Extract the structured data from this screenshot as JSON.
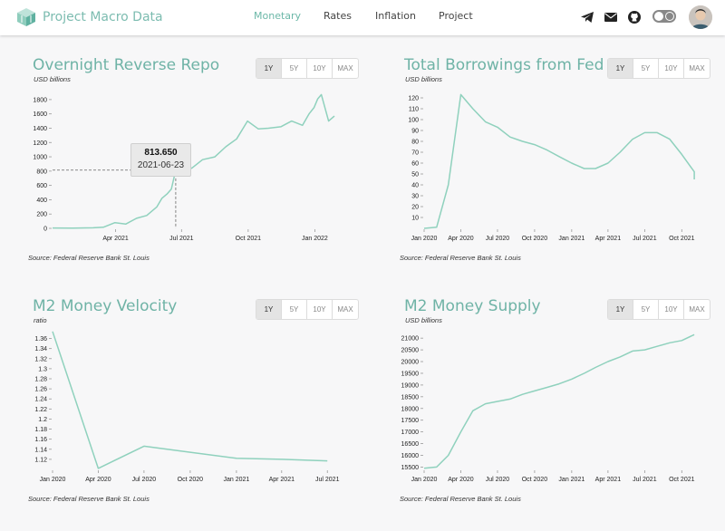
{
  "header": {
    "brand": "Project Macro Data",
    "nav": [
      {
        "label": "Monetary",
        "active": true
      },
      {
        "label": "Rates",
        "active": false
      },
      {
        "label": "Inflation",
        "active": false
      },
      {
        "label": "Project",
        "active": false
      }
    ],
    "icons": [
      "telegram-icon",
      "mail-icon",
      "github-icon",
      "theme-toggle",
      "avatar"
    ],
    "accent_color": "#6fb3a6"
  },
  "range_options": [
    "1Y",
    "5Y",
    "10Y",
    "MAX"
  ],
  "selected_range": "1Y",
  "charts": [
    {
      "title": "Overnight Reverse Repo",
      "unit": "USD billions",
      "source": "Source: Federal Reserve Bank St. Louis",
      "tooltip": {
        "value": "813.650",
        "date": "2021-06-23"
      }
    },
    {
      "title": "Total Borrowings from Fed",
      "unit": "USD billions",
      "source": "Source: Federal Reserve Bank St. Louis"
    },
    {
      "title": "M2 Money Velocity",
      "unit": "ratio",
      "source": "Source: Federal Reserve Bank St. Louis"
    },
    {
      "title": "M2 Money Supply",
      "unit": "USD billions",
      "source": "Source: Federal Reserve Bank St. Louis"
    }
  ],
  "chart_data": [
    {
      "type": "line",
      "title": "Overnight Reverse Repo",
      "ylabel": "USD billions",
      "ylim": [
        0,
        1900
      ],
      "yticks": [
        0,
        200,
        400,
        600,
        800,
        1000,
        1200,
        1400,
        1600,
        1800
      ],
      "xlim": [
        "2021-01-04",
        "2022-01-28"
      ],
      "xticks": [
        [
          "2021-04-01",
          "Apr 2021"
        ],
        [
          "2021-07-01",
          "Jul 2021"
        ],
        [
          "2021-10-01",
          "Oct 2021"
        ],
        [
          "2022-01-01",
          "Jan 2022"
        ]
      ],
      "color": "#8fd1bd",
      "x": [
        "2021-01-04",
        "2021-02-01",
        "2021-03-01",
        "2021-03-15",
        "2021-03-31",
        "2021-04-15",
        "2021-04-30",
        "2021-05-14",
        "2021-05-28",
        "2021-06-04",
        "2021-06-11",
        "2021-06-17",
        "2021-06-23",
        "2021-06-30",
        "2021-07-15",
        "2021-07-30",
        "2021-08-16",
        "2021-08-31",
        "2021-09-15",
        "2021-09-30",
        "2021-10-15",
        "2021-10-29",
        "2021-11-15",
        "2021-11-30",
        "2021-12-15",
        "2021-12-24",
        "2021-12-31",
        "2022-01-05",
        "2022-01-10",
        "2022-01-20",
        "2022-01-28"
      ],
      "series": [
        {
          "values": [
            5,
            2,
            8,
            15,
            80,
            60,
            140,
            180,
            300,
            420,
            480,
            550,
            813.65,
            900,
            840,
            960,
            1000,
            1140,
            1250,
            1500,
            1390,
            1400,
            1420,
            1500,
            1440,
            1600,
            1690,
            1810,
            1870,
            1500,
            1570
          ]
        }
      ],
      "highlight": {
        "x": "2021-06-23",
        "y": 813.65
      }
    },
    {
      "type": "line",
      "title": "Total Borrowings from Fed",
      "ylabel": "USD billions",
      "ylim": [
        0,
        125
      ],
      "yticks": [
        10,
        20,
        30,
        40,
        50,
        60,
        70,
        80,
        90,
        100,
        110,
        120
      ],
      "xlim": [
        "2020-01-01",
        "2021-11-30"
      ],
      "xticks": [
        [
          "2020-01-01",
          "Jan 2020"
        ],
        [
          "2020-04-01",
          "Apr 2020"
        ],
        [
          "2020-07-01",
          "Jul 2020"
        ],
        [
          "2020-10-01",
          "Oct 2020"
        ],
        [
          "2021-01-01",
          "Jan 2021"
        ],
        [
          "2021-04-01",
          "Apr 2021"
        ],
        [
          "2021-07-01",
          "Jul 2021"
        ],
        [
          "2021-10-01",
          "Oct 2021"
        ]
      ],
      "color": "#8fd1bd",
      "x": [
        "2020-01-01",
        "2020-02-01",
        "2020-03-01",
        "2020-04-01",
        "2020-05-01",
        "2020-06-01",
        "2020-07-01",
        "2020-08-01",
        "2020-09-01",
        "2020-10-01",
        "2020-11-01",
        "2020-12-01",
        "2021-01-01",
        "2021-02-01",
        "2021-03-01",
        "2021-04-01",
        "2021-05-01",
        "2021-06-01",
        "2021-07-01",
        "2021-08-01",
        "2021-09-01",
        "2021-10-01",
        "2021-11-01"
      ],
      "series": [
        {
          "values": [
            0,
            1,
            40,
            123,
            110,
            98,
            93,
            84,
            80,
            77,
            72,
            66,
            60,
            55,
            55,
            60,
            70,
            82,
            88,
            88,
            82,
            68,
            52,
            45
          ]
        }
      ]
    },
    {
      "type": "line",
      "title": "M2 Money Velocity",
      "ylabel": "ratio",
      "ylim": [
        1.1,
        1.37
      ],
      "yticks": [
        1.12,
        1.14,
        1.16,
        1.18,
        1.2,
        1.22,
        1.24,
        1.26,
        1.28,
        1.3,
        1.32,
        1.34,
        1.36
      ],
      "xlim": [
        "2020-01-01",
        "2021-07-15"
      ],
      "xticks": [
        [
          "2020-01-01",
          "Jan 2020"
        ],
        [
          "2020-04-01",
          "Apr 2020"
        ],
        [
          "2020-07-01",
          "Jul 2020"
        ],
        [
          "2020-10-01",
          "Oct 2020"
        ],
        [
          "2021-01-01",
          "Jan 2021"
        ],
        [
          "2021-04-01",
          "Apr 2021"
        ],
        [
          "2021-07-01",
          "Jul 2021"
        ]
      ],
      "color": "#8fd1bd",
      "x": [
        "2020-01-01",
        "2020-04-01",
        "2020-07-01",
        "2020-10-01",
        "2021-01-01",
        "2021-04-01",
        "2021-07-01"
      ],
      "series": [
        {
          "values": [
            1.374,
            1.102,
            1.146,
            1.134,
            1.122,
            1.12,
            1.117
          ]
        }
      ]
    },
    {
      "type": "line",
      "title": "M2 Money Supply",
      "ylabel": "USD billions",
      "ylim": [
        15400,
        21200
      ],
      "yticks": [
        15500,
        16000,
        16500,
        17000,
        17500,
        18000,
        18500,
        19000,
        19500,
        20000,
        20500,
        21000
      ],
      "xlim": [
        "2020-01-01",
        "2021-11-30"
      ],
      "xticks": [
        [
          "2020-01-01",
          "Jan 2020"
        ],
        [
          "2020-04-01",
          "Apr 2020"
        ],
        [
          "2020-07-01",
          "Jul 2020"
        ],
        [
          "2020-10-01",
          "Oct 2020"
        ],
        [
          "2021-01-01",
          "Jan 2021"
        ],
        [
          "2021-04-01",
          "Apr 2021"
        ],
        [
          "2021-07-01",
          "Jul 2021"
        ],
        [
          "2021-10-01",
          "Oct 2021"
        ]
      ],
      "color": "#8fd1bd",
      "x": [
        "2020-01-01",
        "2020-02-01",
        "2020-03-01",
        "2020-04-01",
        "2020-05-01",
        "2020-06-01",
        "2020-07-01",
        "2020-08-01",
        "2020-09-01",
        "2020-10-01",
        "2020-11-01",
        "2020-12-01",
        "2021-01-01",
        "2021-02-01",
        "2021-03-01",
        "2021-04-01",
        "2021-05-01",
        "2021-06-01",
        "2021-07-01",
        "2021-08-01",
        "2021-09-01",
        "2021-10-01",
        "2021-11-01"
      ],
      "series": [
        {
          "values": [
            15450,
            15500,
            16000,
            17000,
            17900,
            18200,
            18300,
            18400,
            18600,
            18750,
            18900,
            19050,
            19250,
            19500,
            19750,
            20000,
            20200,
            20450,
            20500,
            20650,
            20800,
            20900,
            21150
          ]
        }
      ]
    }
  ]
}
